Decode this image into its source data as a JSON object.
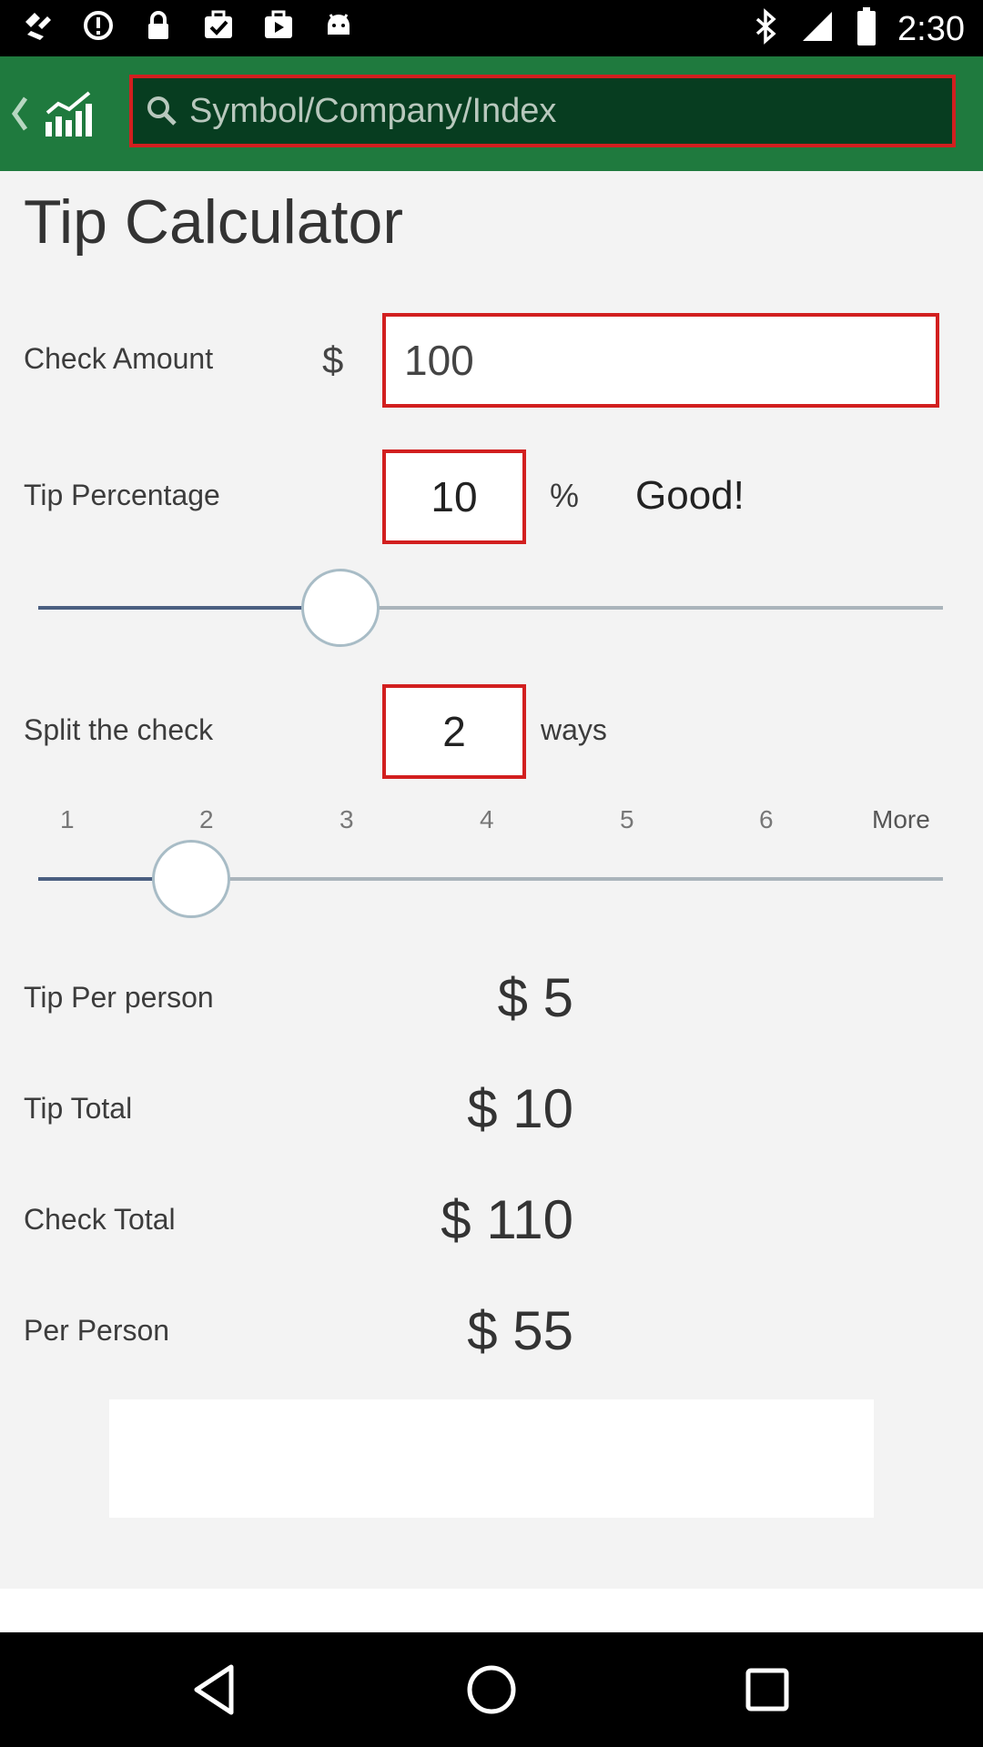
{
  "status_bar": {
    "time": "2:30",
    "left_icons": [
      "fake-gps-icon",
      "alert-icon",
      "lock-icon",
      "task-icon",
      "play-store-icon",
      "android-icon"
    ],
    "right_icons": [
      "bluetooth-icon",
      "signal-icon",
      "battery-icon"
    ]
  },
  "app_bar": {
    "search_placeholder": "Symbol/Company/Index",
    "accent_color": "#1f7a3e",
    "search_bg": "#073d20"
  },
  "title": "Tip Calculator",
  "check_amount": {
    "label": "Check Amount",
    "currency": "$",
    "value": "100"
  },
  "tip_percentage": {
    "label": "Tip Percentage",
    "value": "10",
    "unit": "%",
    "rating": "Good!",
    "slider_level": 0.33
  },
  "split": {
    "label": "Split the check",
    "value": "2",
    "unit": "ways",
    "ticks": [
      "1",
      "2",
      "3",
      "4",
      "5",
      "6",
      "More"
    ],
    "selected": "2"
  },
  "results": [
    {
      "label": "Tip Per person",
      "value": "$ 5"
    },
    {
      "label": "Tip Total",
      "value": "$ 10"
    },
    {
      "label": "Check Total",
      "value": "$ 110"
    },
    {
      "label": "Per Person",
      "value": "$ 55"
    }
  ],
  "highlight_color": "#d21f1f"
}
